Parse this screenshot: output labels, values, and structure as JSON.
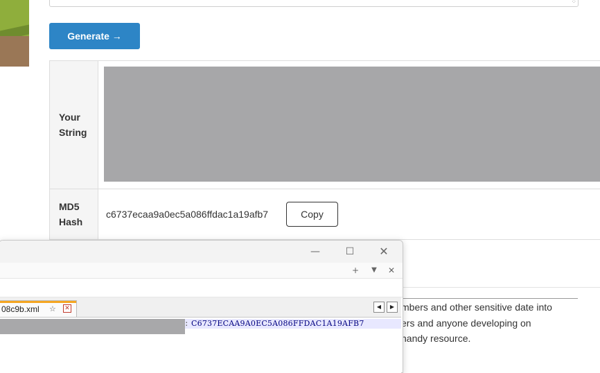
{
  "generator": {
    "button_label": "Generate →"
  },
  "result": {
    "your_string_label": "Your String",
    "md5_label": "MD5 Hash",
    "md5_value": "c6737ecaa9a0ec5a086ffdac1a19afb7",
    "copy_label": "Copy"
  },
  "article": {
    "lines": [
      "mbers and other sensitive date into",
      "ers and anyone developing on",
      "handy resource."
    ]
  },
  "editor_window": {
    "tab_label": "08c9b.xml",
    "code_line": "C6737ECAA9A0EC5A086FFDAC1A19AFB7",
    "controls": {
      "minimize": "—",
      "maximize": "☐",
      "close": "✕",
      "new_tab": "+",
      "tab_list": "▼",
      "close_tab_bar": "✕"
    }
  },
  "icons": {
    "pin": "pin-icon",
    "tab_close": "close-icon",
    "resize": "resize-grip-icon"
  },
  "colors": {
    "accent": "#2d85c6",
    "tab_accent": "#f5a623",
    "tab_close": "#c0392b"
  }
}
